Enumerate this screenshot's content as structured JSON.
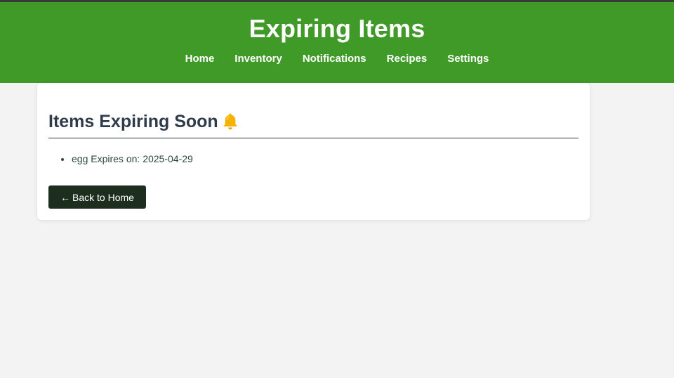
{
  "header": {
    "title": "Expiring Items",
    "nav": [
      {
        "label": "Home"
      },
      {
        "label": "Inventory"
      },
      {
        "label": "Notifications"
      },
      {
        "label": "Recipes"
      },
      {
        "label": "Settings"
      }
    ]
  },
  "main": {
    "heading": "Items Expiring Soon",
    "heading_icon": "bell-icon",
    "items": [
      {
        "name": "egg",
        "expires_label": "Expires on:",
        "date": "2025-04-29"
      }
    ],
    "back_button": {
      "arrow": "←",
      "label": "Back to Home"
    }
  },
  "colors": {
    "header_bg": "#3f9a27",
    "page_bg": "#f3f3f3",
    "heading": "#2f3b4b",
    "button_bg": "#1d2e1f",
    "bell": "#f5b301"
  }
}
